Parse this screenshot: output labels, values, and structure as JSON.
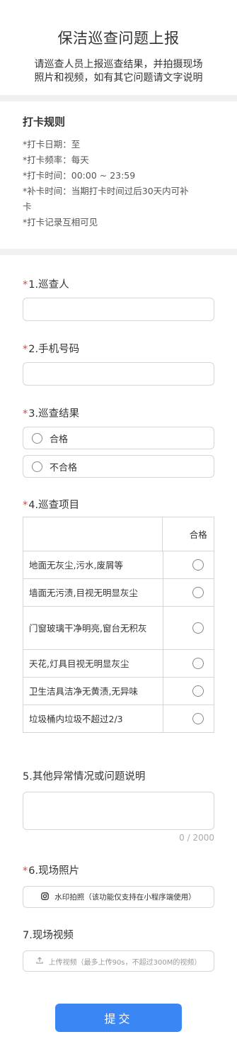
{
  "header": {
    "title": "保洁巡查问题上报",
    "description_line1": "请巡查人员上报巡查结果，并拍摄现场",
    "description_line2": "照片和视频，如有其它问题请文字说明"
  },
  "rules": {
    "title": "打卡规则",
    "lines": [
      "*打卡日期：至",
      "*打卡频率：每天",
      "*打卡时间：00:00 ~ 23:59",
      "*补卡时间：当期打卡时间过后30天内可补",
      "卡",
      "*打卡记录互相可见"
    ]
  },
  "questions": {
    "q1": {
      "required": "*",
      "label": "1.巡查人"
    },
    "q2": {
      "required": "*",
      "label": "2.手机号码"
    },
    "q3": {
      "required": "*",
      "label": "3.巡查结果",
      "options": [
        "合格",
        "不合格"
      ]
    },
    "q4": {
      "required": "*",
      "label": "4.巡查项目",
      "column_header": "合格",
      "rows": [
        "地面无灰尘,污水,废屑等",
        "墙面无污渍,目视无明显灰尘",
        "门窗玻璃干净明亮,窗台无积灰",
        "天花,灯具目视无明显灰尘",
        "卫生洁具洁净无黄渍,无异味",
        "垃圾桶内垃圾不超过2/3"
      ]
    },
    "q5": {
      "label": "5.其他异常情况或问题说明",
      "counter": "0 / 2000"
    },
    "q6": {
      "required": "*",
      "label": "6.现场照片",
      "button_label": "水印拍照（该功能仅支持在小程序端使用）",
      "icon": "camera-icon"
    },
    "q7": {
      "label": "7.现场视频",
      "button_label": "上传视频（最多上传90s，不超过300M的视频）",
      "icon": "upload-icon"
    }
  },
  "submit_label": "提交",
  "colors": {
    "primary": "#3a86f5",
    "required": "#e64340",
    "divider": "#f0f0f0",
    "border": "#d6d6d6"
  }
}
